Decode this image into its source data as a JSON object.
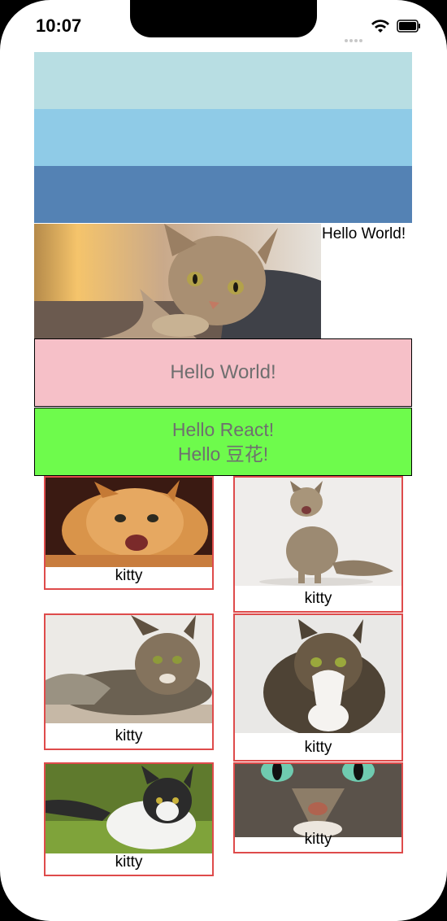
{
  "status_bar": {
    "time": "10:07"
  },
  "header": {
    "hero_caption": "Hello World!"
  },
  "boxes": {
    "pink_text": "Hello World!",
    "green_line1": "Hello React!",
    "green_line2": "Hello 豆花!"
  },
  "cards": [
    {
      "caption": "kitty",
      "cat": "ginger-kitten"
    },
    {
      "caption": "kitty",
      "cat": "tabby-sitting"
    },
    {
      "caption": "kitty",
      "cat": "maine-coon-lying"
    },
    {
      "caption": "kitty",
      "cat": "tabby-white"
    },
    {
      "caption": "kitty",
      "cat": "black-white-grass"
    },
    {
      "caption": "kitty",
      "cat": "closeup-eyes"
    }
  ],
  "colors": {
    "stripe_1": "#b8dee3",
    "stripe_2": "#8fcbe7",
    "stripe_3": "#5482b4",
    "pink_box": "#f6c0c8",
    "green_box": "#6efb4c",
    "card_border": "#de4b4b"
  }
}
